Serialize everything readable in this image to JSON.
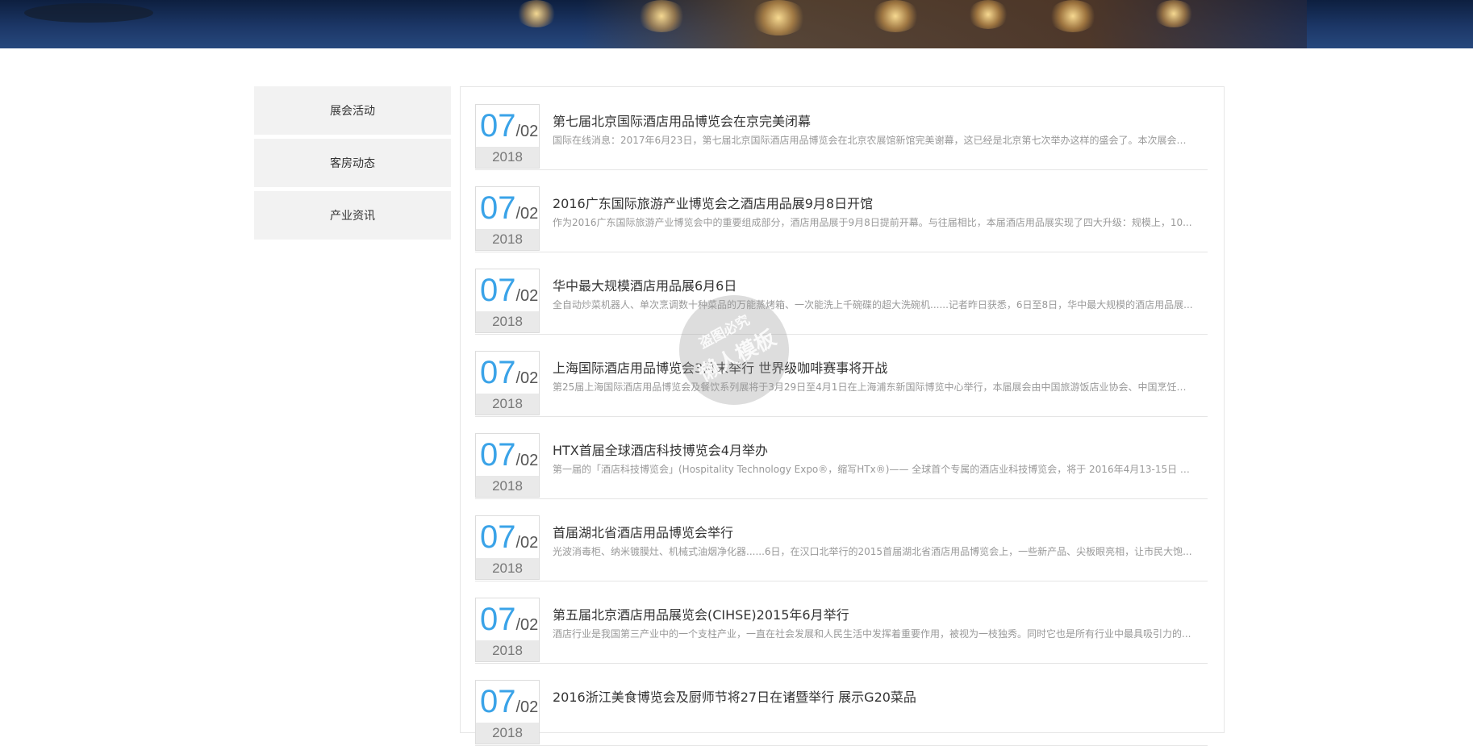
{
  "sidebar": {
    "items": [
      {
        "label": "展会活动"
      },
      {
        "label": "客房动态"
      },
      {
        "label": "产业资讯"
      }
    ]
  },
  "news": [
    {
      "month": "07",
      "day": "/02",
      "year": "2018",
      "title": "第七届北京国际酒店用品博览会在京完美闭幕",
      "summary": "国际在线消息：2017年6月23日，第七届北京国际酒店用品博览会在北京农展馆新馆完美谢幕，这已经是北京第七次举办这样的盛会了。本次展会由..."
    },
    {
      "month": "07",
      "day": "/02",
      "year": "2018",
      "title": "2016广东国际旅游产业博览会之酒店用品展9月8日开馆",
      "summary": "作为2016广东国际旅游产业博览会中的重要组成部分，酒店用品展于9月8日提前开幕。与往届相比，本届酒店用品展实现了四大升级：规模上，10..."
    },
    {
      "month": "07",
      "day": "/02",
      "year": "2018",
      "title": "华中最大规模酒店用品展6月6日",
      "summary": "全自动炒菜机器人、单次烹调数十种菜品的万能蒸烤箱、一次能洗上千碗碟的超大洗碗机......记者昨日获悉，6日至8日，华中最大规模的酒店用品展..."
    },
    {
      "month": "07",
      "day": "/02",
      "year": "2018",
      "title": "上海国际酒店用品博览会3月末举行 世界级咖啡赛事将开战",
      "summary": "第25届上海国际酒店用品博览会及餐饮系列展将于3月29日至4月1日在上海浦东新国际博览中心举行，本届展会由中国旅游饭店业协会、中国烹饪协..."
    },
    {
      "month": "07",
      "day": "/02",
      "year": "2018",
      "title": "HTX首届全球酒店科技博览会4月举办",
      "summary": "第一届的「酒店科技博览会」(Hospitality Technology Expo®，缩写HTx®)—— 全球首个专属的酒店业科技博览会，将于 2016年4月13-15日 在 北..."
    },
    {
      "month": "07",
      "day": "/02",
      "year": "2018",
      "title": "首届湖北省酒店用品博览会举行",
      "summary": "光波消毒柜、纳米镀膜灶、机械式油烟净化器......6日，在汉口北举行的2015首届湖北省酒店用品博览会上，一些新产品、尖板眼亮相，让市民大饱..."
    },
    {
      "month": "07",
      "day": "/02",
      "year": "2018",
      "title": "第五届北京酒店用品展览会(CIHSE)2015年6月举行",
      "summary": "酒店行业是我国第三产业中的一个支柱产业，一直在社会发展和人民生活中发挥着重要作用，被视为一枝独秀。同时它也是所有行业中最具吸引力的..."
    },
    {
      "month": "07",
      "day": "/02",
      "year": "2018",
      "title": "2016浙江美食博览会及厨师节将27日在诸暨举行 展示G20菜品",
      "summary": ""
    }
  ],
  "watermark": {
    "line1": "盗图必究",
    "line2": "懒人模板"
  }
}
